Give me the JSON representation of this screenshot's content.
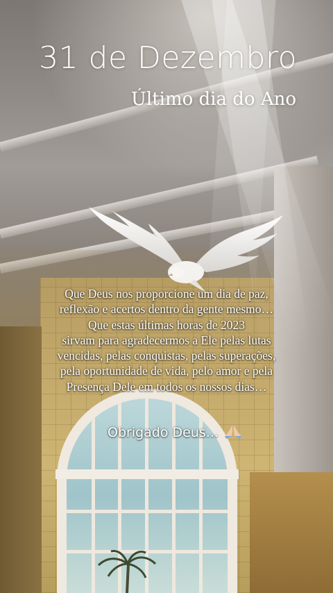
{
  "story": {
    "date": "31 de Dezembro",
    "subtitle": "Último dia do Ano",
    "message_lines": [
      "Que Deus nos proporcione um dia de paz,",
      "reflexão e acertos dentro da gente mesmo…",
      "Que estas últimas horas de 2023",
      "sirvam para agradecermos a Ele pelas lutas",
      "vencidas, pelas conquistas, pelas superações,",
      "pela oportunidade de vida, pelo amor e pela",
      "Presença Dele em todos os nossos dias…"
    ],
    "thanks": "Obrigado Deus...",
    "thanks_icon": "praying-hands-icon"
  }
}
